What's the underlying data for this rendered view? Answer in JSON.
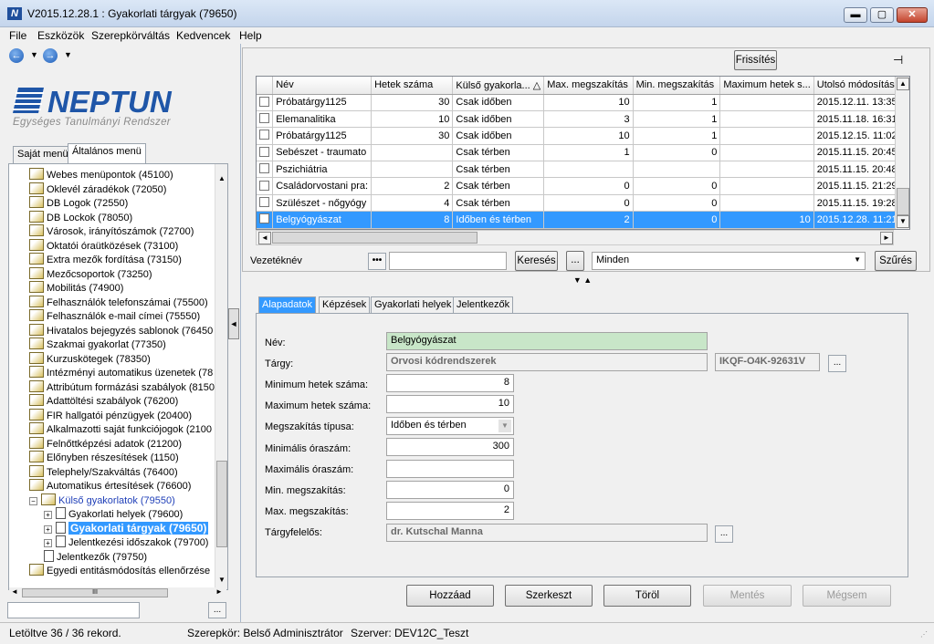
{
  "window": {
    "title": "V2015.12.28.1 : Gyakorlati tárgyak (79650)",
    "app_icon": "N",
    "min": "▬",
    "max": "▢",
    "close": "✕"
  },
  "menu": [
    "File",
    "Eszközök",
    "Szerepkörváltás",
    "Kedvencek",
    "Help"
  ],
  "logo": {
    "name": "NEPTUN",
    "subtitle": "Egységes Tanulmányi Rendszer"
  },
  "left_tabs": [
    "Saját menü",
    "Általános menü"
  ],
  "tree": [
    {
      "label": "Webes menüpontok (45100)",
      "level": 0
    },
    {
      "label": "Oklevél záradékok (72050)",
      "level": 0
    },
    {
      "label": "DB Logok (72550)",
      "level": 0
    },
    {
      "label": "DB Lockok (78050)",
      "level": 0
    },
    {
      "label": "Városok, irányítószámok (72700)",
      "level": 0
    },
    {
      "label": "Oktatói óraütközések (73100)",
      "level": 0
    },
    {
      "label": "Extra mezők fordítása (73150)",
      "level": 0
    },
    {
      "label": "Mezőcsoportok (73250)",
      "level": 0
    },
    {
      "label": "Mobilitás (74900)",
      "level": 0
    },
    {
      "label": "Felhasználók telefonszámai (75500)",
      "level": 0
    },
    {
      "label": "Felhasználók e-mail címei (75550)",
      "level": 0
    },
    {
      "label": "Hivatalos bejegyzés sablonok (76450",
      "level": 0
    },
    {
      "label": "Szakmai gyakorlat (77350)",
      "level": 0
    },
    {
      "label": "Kurzuskötegek (78350)",
      "level": 0
    },
    {
      "label": "Intézményi automatikus üzenetek (78",
      "level": 0
    },
    {
      "label": "Attribútum formázási szabályok (8150",
      "level": 0
    },
    {
      "label": "Adattöltési szabályok (76200)",
      "level": 0
    },
    {
      "label": "FIR hallgatói pénzügyek (20400)",
      "level": 0
    },
    {
      "label": "Alkalmazotti saját funkciójogok (2100",
      "level": 0
    },
    {
      "label": "Felnőttképzési adatok (21200)",
      "level": 0
    },
    {
      "label": "Előnyben részesítések (1150)",
      "level": 0
    },
    {
      "label": "Telephely/Szakváltás (76400)",
      "level": 0
    },
    {
      "label": "Automatikus értesítések (76600)",
      "level": 0
    },
    {
      "label": "Külső gyakorlatok (79550)",
      "level": 0,
      "expander": "−",
      "blue": true
    },
    {
      "label": "Gyakorlati helyek (79600)",
      "level": 1,
      "expander": "+"
    },
    {
      "label": "Gyakorlati tárgyak (79650)",
      "level": 1,
      "expander": "+",
      "selected": true
    },
    {
      "label": "Jelentkezési időszakok (79700)",
      "level": 1,
      "expander": "+"
    },
    {
      "label": "Jelentkezők (79750)",
      "level": 1
    },
    {
      "label": "Egyedi entitásmódosítás ellenőrzése",
      "level": 0
    }
  ],
  "left_hscroll_label": "III",
  "toolbar": {
    "refresh": "Frissítés",
    "pin": "⊣"
  },
  "grid": {
    "columns": [
      "",
      "Név",
      "Hetek száma",
      "Külső gyakorla... △",
      "Max. megszakítás",
      "Min. megszakítás",
      "Maximum hetek s...",
      "Utolsó módosítás ..."
    ],
    "rows": [
      [
        "",
        "Próbatárgy1125",
        "30",
        "Csak időben",
        "10",
        "1",
        "",
        "2015.12.11. 13:35:3"
      ],
      [
        "",
        "Elemanalitika",
        "10",
        "Csak időben",
        "3",
        "1",
        "",
        "2015.11.18. 16:31:1"
      ],
      [
        "",
        "Próbatárgy1125",
        "30",
        "Csak időben",
        "10",
        "1",
        "",
        "2015.12.15. 11:02:2"
      ],
      [
        "",
        "Sebészet - traumato",
        "",
        "Csak térben",
        "1",
        "0",
        "",
        "2015.11.15. 20:45:0"
      ],
      [
        "",
        "Pszichiátria",
        "",
        "Csak térben",
        "",
        "",
        "",
        "2015.11.15. 20:48:3"
      ],
      [
        "",
        "Családorvostani pra:",
        "2",
        "Csak térben",
        "0",
        "0",
        "",
        "2015.11.15. 21:29:1"
      ],
      [
        "",
        "Szülészet - nőgyógy",
        "4",
        "Csak térben",
        "0",
        "0",
        "",
        "2015.11.15. 19:28:3"
      ],
      [
        "",
        "Belgyógyászat",
        "8",
        "Időben és térben",
        "2",
        "0",
        "10",
        "2015.12.28. 11:21:2"
      ]
    ],
    "selected_row": 7
  },
  "filter": {
    "label": "Vezetéknév",
    "dots": "•••",
    "value": "",
    "search": "Keresés",
    "ellipsis": "...",
    "combo": "Minden",
    "filter": "Szűrés"
  },
  "detail_tabs": [
    "Alapadatok",
    "Képzések",
    "Gyakorlati helyek",
    "Jelentkezők"
  ],
  "form": {
    "nev_label": "Név:",
    "nev": "Belgyógyászat",
    "targy_label": "Tárgy:",
    "targy": "Orvosi kódrendszerek",
    "targy_code": "IKQF-O4K-92631V",
    "min_hetek_label": "Minimum hetek száma:",
    "min_hetek": "8",
    "max_hetek_label": "Maximum hetek száma:",
    "max_hetek": "10",
    "megsz_tipus_label": "Megszakítás típusa:",
    "megsz_tipus": "Időben és térben",
    "min_oraszam_label": "Minimális óraszám:",
    "min_oraszam": "300",
    "max_oraszam_label": "Maximális óraszám:",
    "max_oraszam": "",
    "min_megsz_label": "Min. megszakítás:",
    "min_megsz": "0",
    "max_megsz_label": "Max. megszakítás:",
    "max_megsz": "2",
    "felelos_label": "Tárgyfelelős:",
    "felelos": "dr. Kutschal Manna"
  },
  "actions": [
    "Hozzáad",
    "Szerkeszt",
    "Töröl",
    "Mentés",
    "Mégsem"
  ],
  "status": {
    "records": "Letöltve 36 / 36 rekord.",
    "role": "Szerepkör: Belső Adminisztrátor",
    "server": "Szerver: DEV12C_Teszt"
  }
}
